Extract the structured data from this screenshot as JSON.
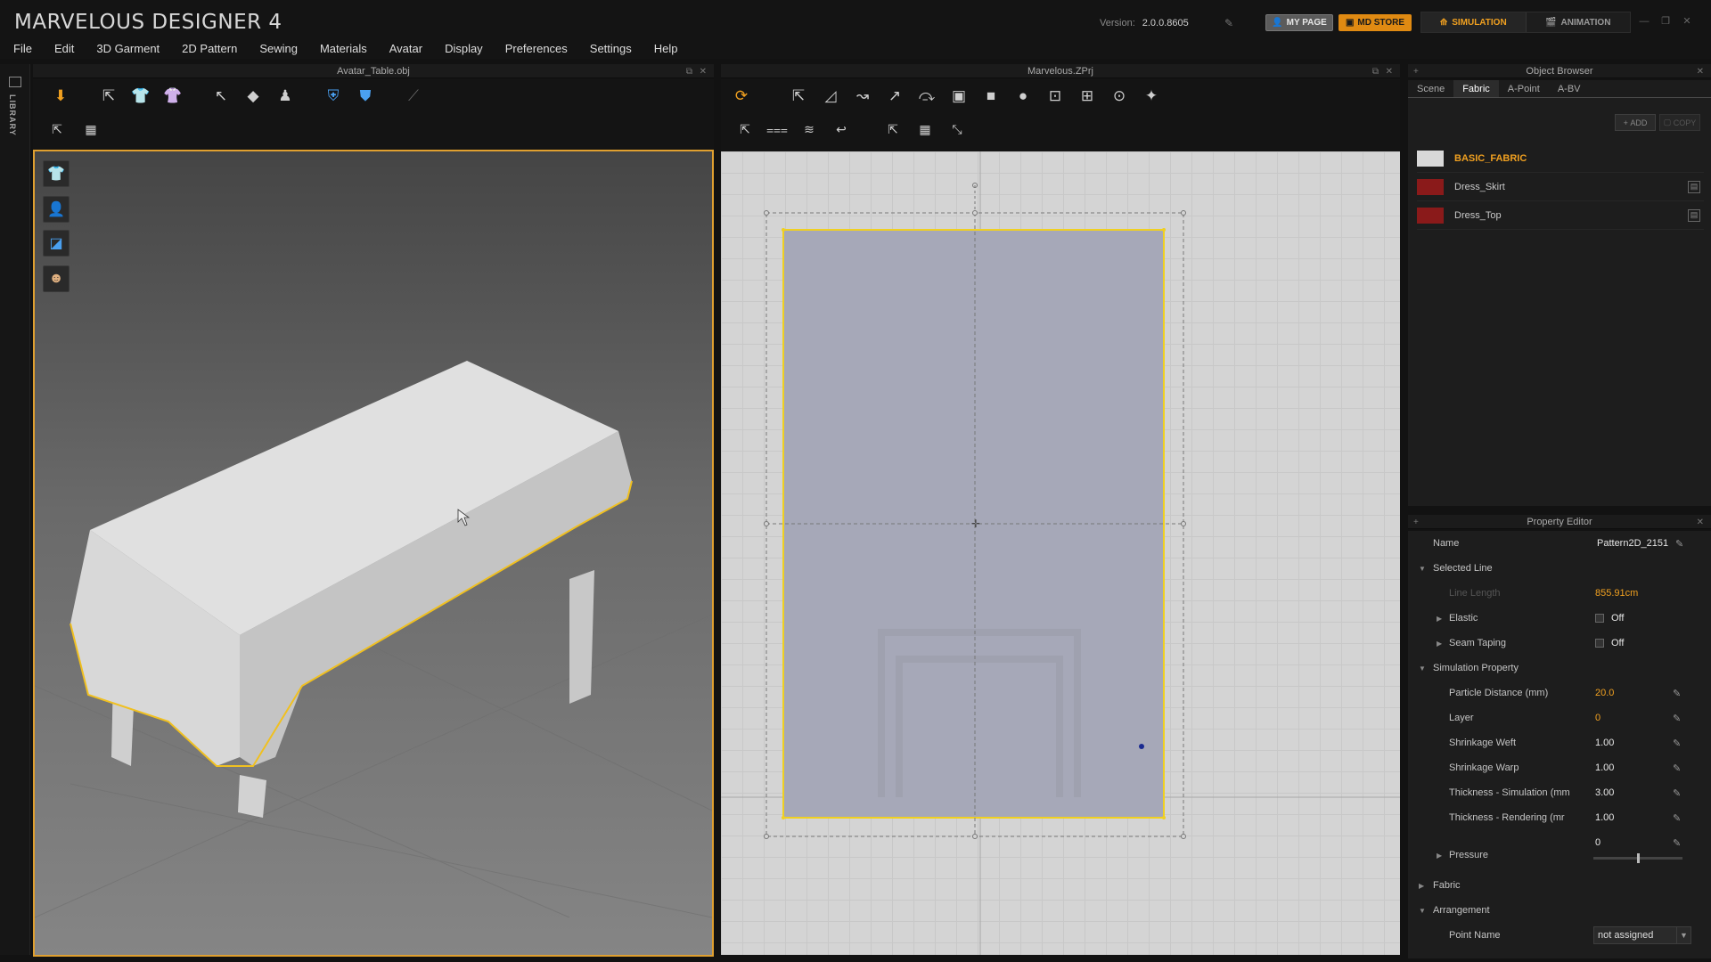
{
  "app": {
    "title": "MARVELOUS DESIGNER 4",
    "version_label": "Version:",
    "version_value": "2.0.0.8605",
    "mypage_label": "MY PAGE",
    "mdstore_label": "MD STORE",
    "mode_simulation": "SIMULATION",
    "mode_animation": "ANIMATION"
  },
  "menu": [
    "File",
    "Edit",
    "3D Garment",
    "2D Pattern",
    "Sewing",
    "Materials",
    "Avatar",
    "Display",
    "Preferences",
    "Settings",
    "Help"
  ],
  "library_label": "LIBRARY",
  "panels": {
    "left_title": "Avatar_Table.obj",
    "center_title": "Marvelous.ZPrj"
  },
  "object_browser": {
    "title": "Object Browser",
    "tabs": [
      "Scene",
      "Fabric",
      "A-Point",
      "A-BV"
    ],
    "active_tab": "Fabric",
    "add_label": "ADD",
    "copy_label": "COPY",
    "fabrics": [
      {
        "name": "BASIC_FABRIC",
        "color": "#d8d8d8"
      },
      {
        "name": "Dress_Skirt",
        "color": "#8a1a1a"
      },
      {
        "name": "Dress_Top",
        "color": "#8a1a1a"
      }
    ]
  },
  "property_editor": {
    "title": "Property Editor",
    "name_label": "Name",
    "name_value": "Pattern2D_2151",
    "selected_line": "Selected Line",
    "line_length_label": "Line Length",
    "line_length_value": "855.91cm",
    "elastic_label": "Elastic",
    "elastic_value": "Off",
    "seam_taping_label": "Seam Taping",
    "seam_taping_value": "Off",
    "simulation_property": "Simulation Property",
    "particle_distance_label": "Particle Distance (mm)",
    "particle_distance_value": "20.0",
    "layer_label": "Layer",
    "layer_value": "0",
    "shrinkage_weft_label": "Shrinkage Weft",
    "shrinkage_weft_value": "1.00",
    "shrinkage_warp_label": "Shrinkage Warp",
    "shrinkage_warp_value": "1.00",
    "thickness_sim_label": "Thickness - Simulation (mm",
    "thickness_sim_value": "3.00",
    "thickness_render_label": "Thickness - Rendering (mr",
    "thickness_render_value": "1.00",
    "pressure_value": "0",
    "pressure_label": "Pressure",
    "pressure_slider_level": 0.5,
    "fabric_section": "Fabric",
    "arrangement_section": "Arrangement",
    "point_name_label": "Point Name",
    "point_name_value": "not assigned"
  },
  "colors": {
    "accent": "#f0a020",
    "selection": "#f0d020",
    "pattern_fill": "#a6a8b8"
  }
}
